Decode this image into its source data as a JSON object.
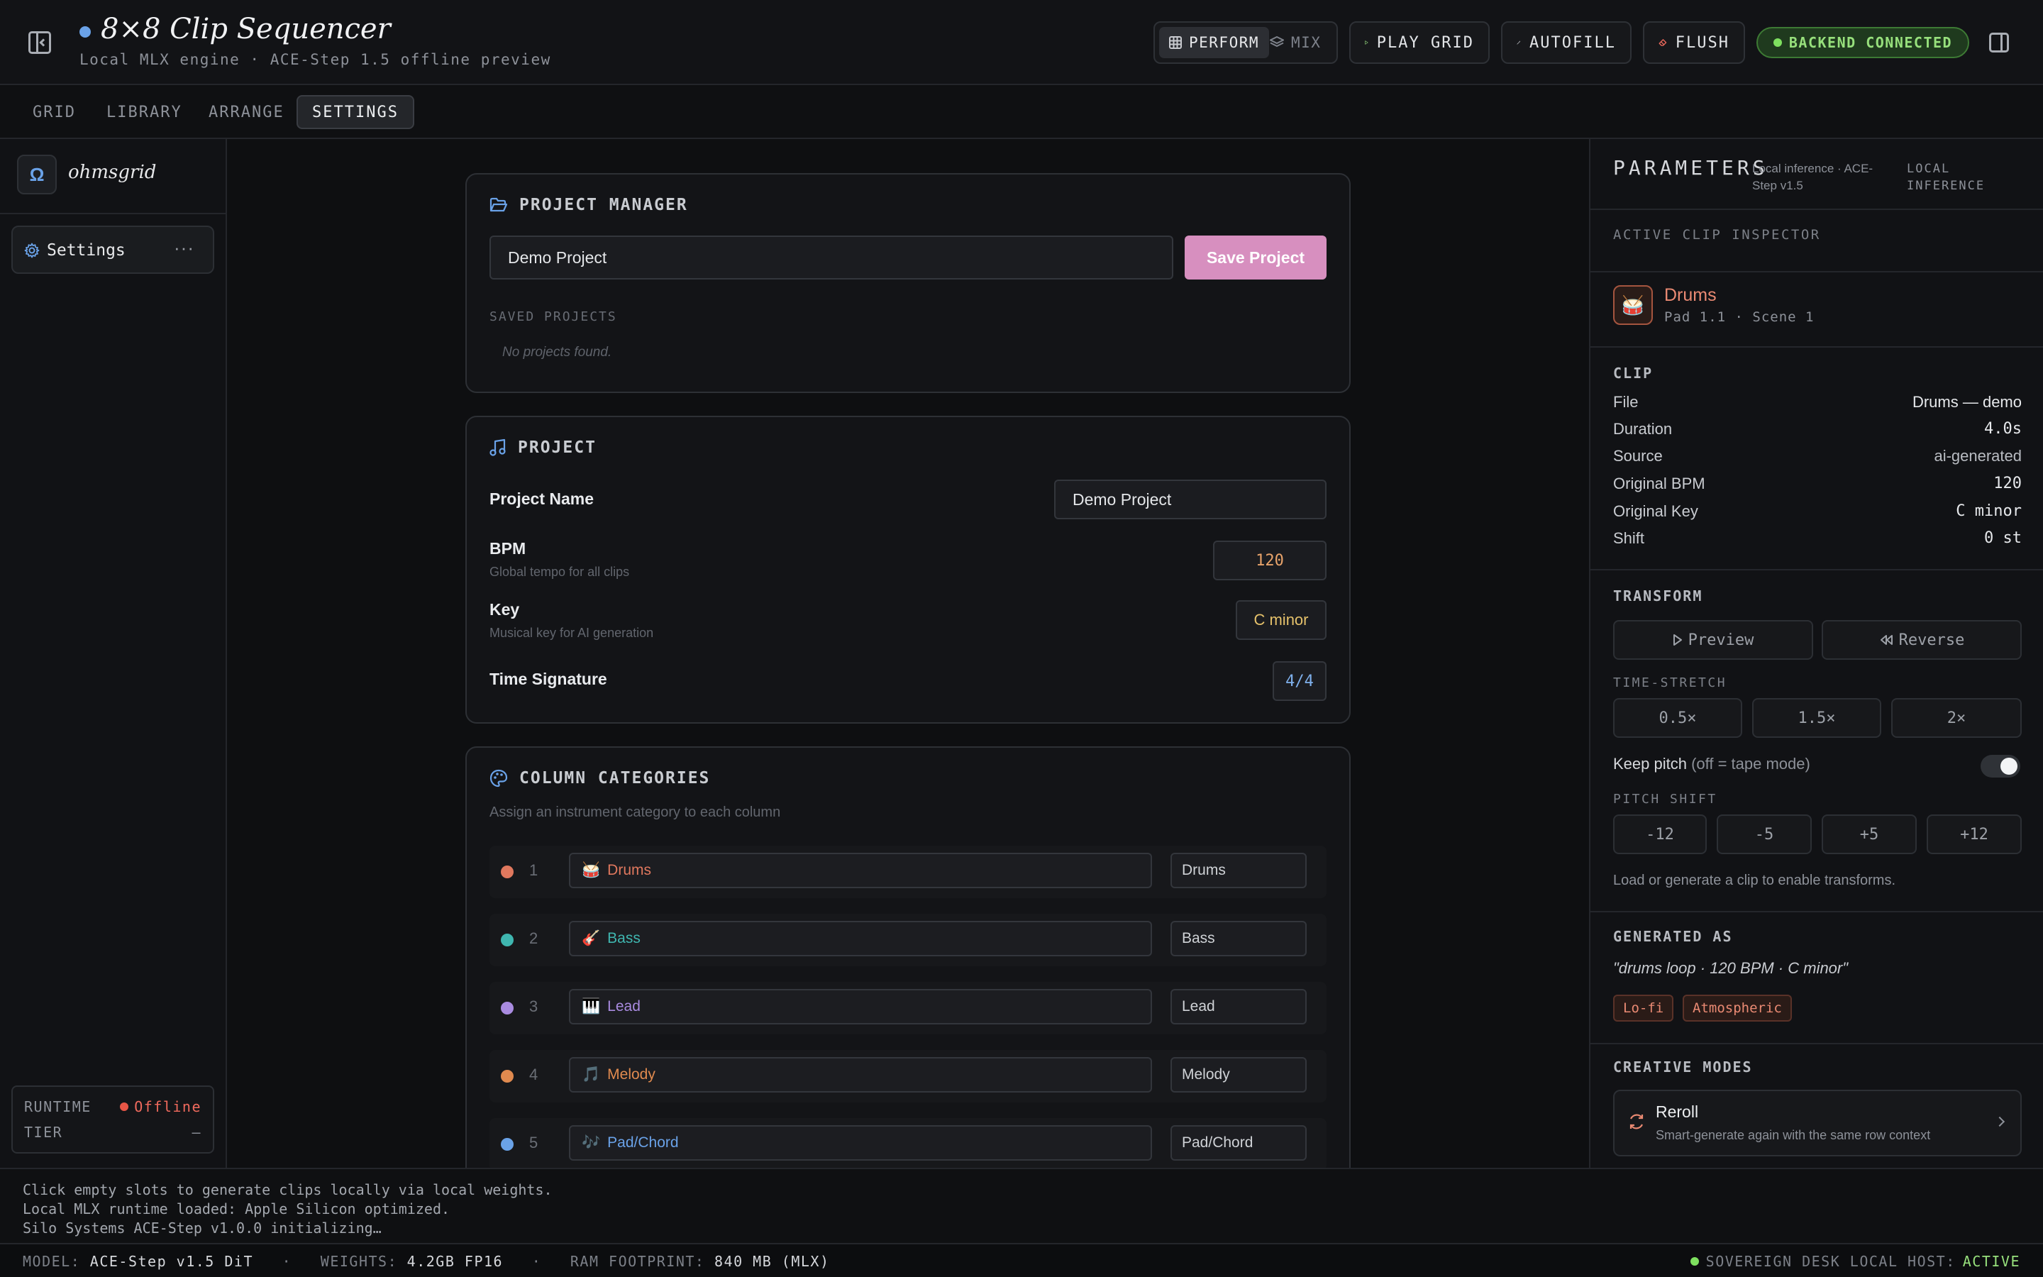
{
  "header": {
    "title": "8×8 Clip Sequencer",
    "subtitle": "Local MLX engine · ACE-Step 1.5 offline preview",
    "mode_perform": "PERFORM",
    "mode_mix": "MIX",
    "play_grid": "PLAY GRID",
    "autofill": "AUTOFILL",
    "flush": "FLUSH",
    "status": "BACKEND CONNECTED"
  },
  "tabs": [
    "GRID",
    "LIBRARY",
    "ARRANGE",
    "SETTINGS"
  ],
  "active_tab": "SETTINGS",
  "sidebar": {
    "brand_letter": "Ω",
    "brand_name": "ohmsgrid",
    "item_label": "Settings",
    "item_more": "···",
    "runtime_label": "RUNTIME",
    "runtime_value": "Offline",
    "tier_label": "TIER",
    "tier_value": "–"
  },
  "project_manager": {
    "title": "PROJECT MANAGER",
    "name_value": "Demo Project",
    "save_label": "Save Project",
    "saved_label": "SAVED PROJECTS",
    "empty_text": "No projects found."
  },
  "project": {
    "title": "PROJECT",
    "name_label": "Project Name",
    "name_value": "Demo Project",
    "bpm_label": "BPM",
    "bpm_hint": "Global tempo for all clips",
    "bpm_value": "120",
    "key_label": "Key",
    "key_hint": "Musical key for AI generation",
    "key_value": "C minor",
    "ts_label": "Time Signature",
    "ts_value": "4/4"
  },
  "categories": {
    "title": "COLUMN CATEGORIES",
    "hint": "Assign an instrument category to each column",
    "rows": [
      {
        "num": "1",
        "icon": "🥁",
        "name": "Drums",
        "select": "Drums",
        "color": "#e0785e"
      },
      {
        "num": "2",
        "icon": "🎸",
        "name": "Bass",
        "select": "Bass",
        "color": "#3fb6b0"
      },
      {
        "num": "3",
        "icon": "🎹",
        "name": "Lead",
        "select": "Lead",
        "color": "#a98be0"
      },
      {
        "num": "4",
        "icon": "🎵",
        "name": "Melody",
        "select": "Melody",
        "color": "#e08a4f"
      },
      {
        "num": "5",
        "icon": "🎶",
        "name": "Pad/Chord",
        "select": "Pad/Chord",
        "color": "#6aa2e8"
      }
    ]
  },
  "params": {
    "title": "PARAMETERS",
    "sub1": "Local inference · ACE-Step v1.5",
    "sub2": "LOCAL INFERENCE",
    "inspector_label": "ACTIVE CLIP INSPECTOR",
    "clip_icon": "🥁",
    "clip_name": "Drums",
    "clip_meta": "Pad 1.1 · Scene 1",
    "clip_head": "CLIP",
    "fields": [
      {
        "k": "File",
        "v": "Drums — demo"
      },
      {
        "k": "Duration",
        "v": "4.0s"
      },
      {
        "k": "Source",
        "v": "ai-generated"
      },
      {
        "k": "Original BPM",
        "v": "120"
      },
      {
        "k": "Original Key",
        "v": "C minor"
      },
      {
        "k": "Shift",
        "v": "0 st"
      }
    ],
    "transform_head": "TRANSFORM",
    "preview": "Preview",
    "reverse": "Reverse",
    "stretch_label": "TIME-STRETCH",
    "stretch": [
      "0.5×",
      "1.5×",
      "2×"
    ],
    "keep_pitch": "Keep pitch",
    "keep_pitch_note": "(off = tape mode)",
    "keep_pitch_on": true,
    "pitch_label": "PITCH SHIFT",
    "pitch": [
      "-12",
      "-5",
      "+5",
      "+12"
    ],
    "transform_note": "Load or generate a clip to enable transforms.",
    "generated_head": "GENERATED AS",
    "generated_prompt": "\"drums loop · 120 BPM · C minor\"",
    "tags": [
      "Lo-fi",
      "Atmospheric"
    ],
    "creative_head": "CREATIVE MODES",
    "reroll_title": "Reroll",
    "reroll_desc": "Smart-generate again with the same row context"
  },
  "console": [
    "Click empty slots to generate clips locally via local weights.",
    "Local MLX runtime loaded: Apple Silicon optimized.",
    "Silo Systems ACE-Step v1.0.0 initializing…"
  ],
  "statusbar": {
    "model_label": "MODEL:",
    "model_value": "ACE-Step v1.5 DiT",
    "weights_label": "WEIGHTS:",
    "weights_value": "4.2GB FP16",
    "ram_label": "RAM FOOTPRINT:",
    "ram_value": "840 MB (MLX)",
    "host_label": "SOVEREIGN DESK LOCAL HOST:",
    "host_value": "ACTIVE",
    "sep": "·"
  },
  "colors": {
    "accent": "#6aa2e8",
    "save": "#d78fbf",
    "connected": "#97e07c",
    "offline": "#f06a5d",
    "clip": "#ea8a73"
  }
}
